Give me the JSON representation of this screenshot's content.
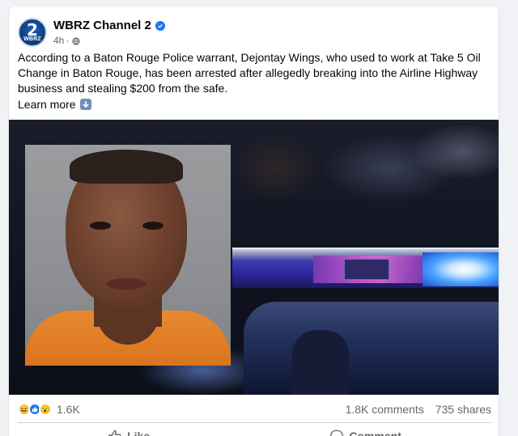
{
  "post": {
    "page_name": "WBRZ Channel 2",
    "avatar": {
      "number": "2",
      "brand": "WBRZ"
    },
    "time": "4h",
    "separator": "·",
    "text": "According to a Baton Rouge Police warrant, Dejontay Wings, who used to work at Take 5 Oil Change in Baton Rouge, has been arrested after allegedly breaking into the Airline Highway business and stealing $200 from the safe.",
    "learn_more": "Learn more"
  },
  "stats": {
    "reaction_count": "1.6K",
    "comments": "1.8K comments",
    "shares": "735 shares"
  },
  "actions": {
    "like": "Like",
    "comment": "Comment"
  },
  "colors": {
    "accent": "#1877f2",
    "secondary_text": "#65676b",
    "shirt": "#e8892f"
  },
  "icons": [
    "verified-badge-icon",
    "globe-icon",
    "down-arrow-icon",
    "haha-reaction-icon",
    "like-reaction-icon",
    "wow-reaction-icon",
    "thumbs-up-icon",
    "comment-bubble-icon"
  ]
}
